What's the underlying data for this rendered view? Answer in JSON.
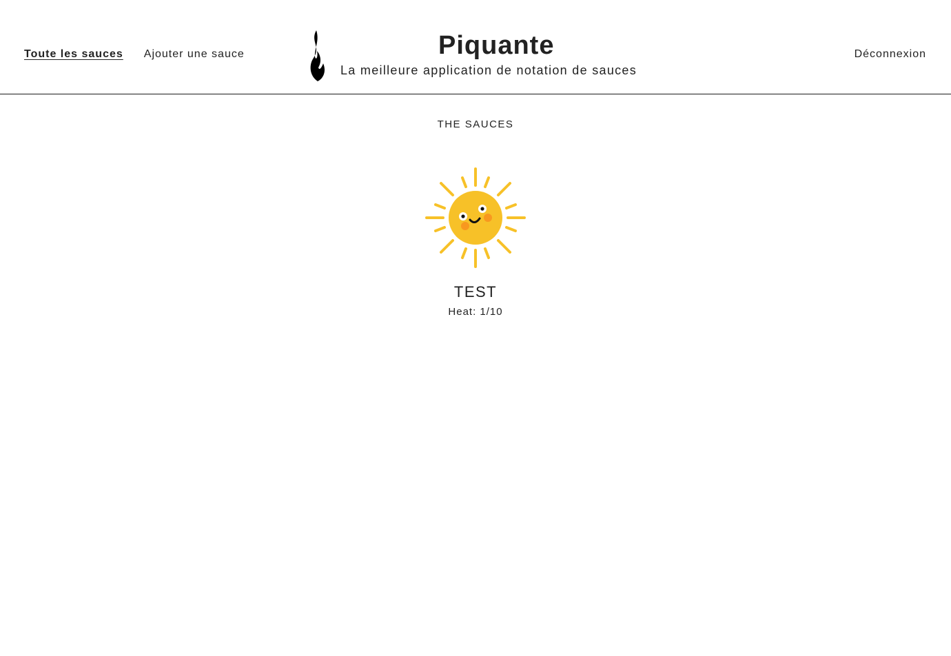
{
  "nav": {
    "all_sauces_label": "Toute les sauces",
    "add_sauce_label": "Ajouter une sauce",
    "logout_label": "Déconnexion"
  },
  "brand": {
    "title": "Piquante",
    "subtitle": "La meilleure application de notation de sauces",
    "logo_icon": "flame-icon"
  },
  "main": {
    "section_title": "THE SAUCES",
    "sauces": [
      {
        "name": "TEST",
        "heat_label": "Heat: 1/10",
        "image_icon": "sun-icon"
      }
    ]
  },
  "colors": {
    "text": "#222222",
    "sun": "#F7C128",
    "cheek": "#F7931E"
  }
}
